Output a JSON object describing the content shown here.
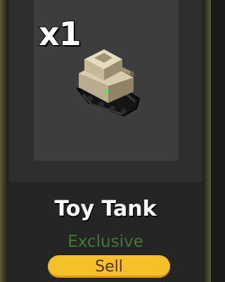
{
  "item": {
    "quantity": "x1",
    "name": "Toy Tank",
    "rarity": "Exclusive",
    "icon": "toy-tank-model"
  },
  "actions": {
    "sell_label": "Sell"
  },
  "colors": {
    "rarity": "#3e7a2f",
    "sell_button": "#f5c02a",
    "card_background": "#2a2a2a",
    "viewport_background": "#3d3d3d"
  }
}
